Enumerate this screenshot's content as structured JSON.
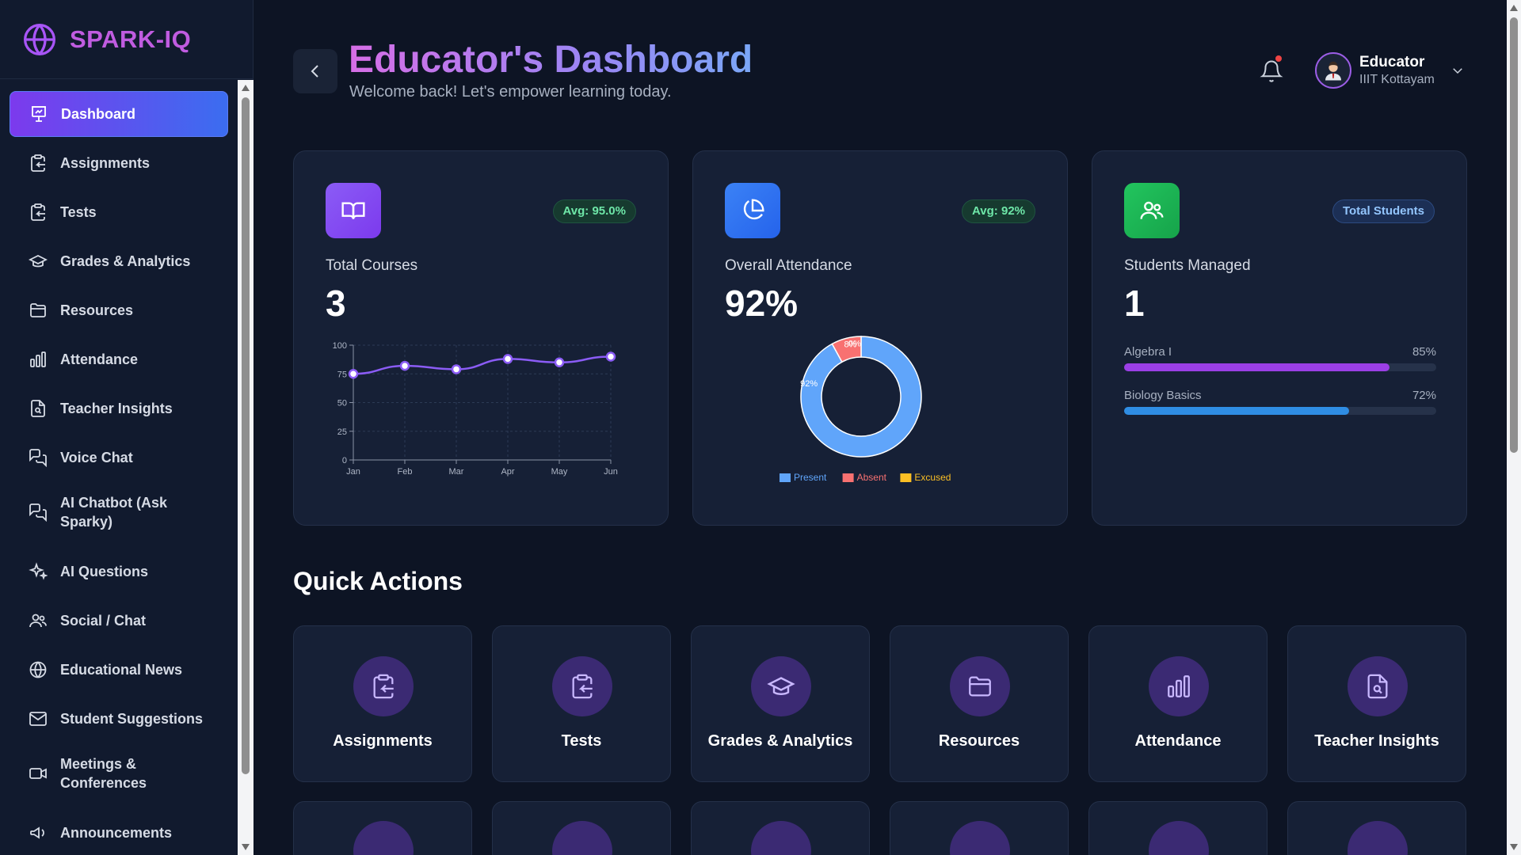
{
  "app": {
    "brand": "SPARK-IQ",
    "accent": "#7c3aed",
    "accent2": "#3b6df0"
  },
  "sidebar": {
    "items": [
      {
        "label": "Dashboard",
        "icon": "presentation-icon",
        "active": true
      },
      {
        "label": "Assignments",
        "icon": "clipboard-copy-icon"
      },
      {
        "label": "Tests",
        "icon": "clipboard-copy-icon"
      },
      {
        "label": "Grades & Analytics",
        "icon": "graduation-cap-icon"
      },
      {
        "label": "Resources",
        "icon": "folder-icon"
      },
      {
        "label": "Attendance",
        "icon": "bar-chart-icon"
      },
      {
        "label": "Teacher Insights",
        "icon": "file-search-icon"
      },
      {
        "label": "Voice Chat",
        "icon": "messages-icon"
      },
      {
        "label": "AI Chatbot (Ask Sparky)",
        "icon": "messages-icon"
      },
      {
        "label": "AI Questions",
        "icon": "sparkles-icon"
      },
      {
        "label": "Social / Chat",
        "icon": "users-icon"
      },
      {
        "label": "Educational News",
        "icon": "globe-icon"
      },
      {
        "label": "Student Suggestions",
        "icon": "mail-icon"
      },
      {
        "label": "Meetings & Conferences",
        "icon": "video-icon"
      },
      {
        "label": "Announcements",
        "icon": "megaphone-icon"
      }
    ]
  },
  "header": {
    "title": "Educator's Dashboard",
    "subtitle": "Welcome back! Let's empower learning today.",
    "user_name": "Educator",
    "user_org": "IIIT Kottayam"
  },
  "cards": {
    "courses": {
      "badge": "Avg: 95.0%",
      "label": "Total Courses",
      "value": "3"
    },
    "attendance": {
      "badge": "Avg: 92%",
      "label": "Overall Attendance",
      "value": "92%"
    },
    "students": {
      "badge": "Total Students",
      "label": "Students Managed",
      "value": "1",
      "progress": [
        {
          "name": "Algebra I",
          "value_label": "85%",
          "value": 0.85,
          "color": "#9b3fe6"
        },
        {
          "name": "Biology Basics",
          "value_label": "72%",
          "value": 0.72,
          "color": "#2f8de4"
        }
      ]
    }
  },
  "chart_data": [
    {
      "type": "line",
      "categories": [
        "Jan",
        "Feb",
        "Mar",
        "Apr",
        "May",
        "Jun"
      ],
      "values": [
        75,
        82,
        79,
        88,
        85,
        90
      ],
      "ylim": [
        0,
        100
      ],
      "yticks": [
        0,
        25,
        50,
        75,
        100
      ],
      "grid": true,
      "color": "#8b5cf6"
    },
    {
      "type": "pie",
      "donut": true,
      "slices": [
        {
          "name": "Present",
          "value": 92,
          "label": "92%",
          "color": "#60a5fa"
        },
        {
          "name": "Absent",
          "value": 8,
          "label": "8%",
          "color": "#f87171"
        },
        {
          "name": "Excused",
          "value": 0,
          "label": "0%",
          "color": "#fbbf24"
        }
      ],
      "legend": "bottom"
    }
  ],
  "quick_actions": {
    "title": "Quick Actions",
    "items": [
      {
        "label": "Assignments",
        "icon": "clipboard-copy-icon"
      },
      {
        "label": "Tests",
        "icon": "clipboard-copy-icon"
      },
      {
        "label": "Grades & Analytics",
        "icon": "graduation-cap-icon"
      },
      {
        "label": "Resources",
        "icon": "folder-icon"
      },
      {
        "label": "Attendance",
        "icon": "bar-chart-icon"
      },
      {
        "label": "Teacher Insights",
        "icon": "file-search-icon"
      }
    ]
  }
}
